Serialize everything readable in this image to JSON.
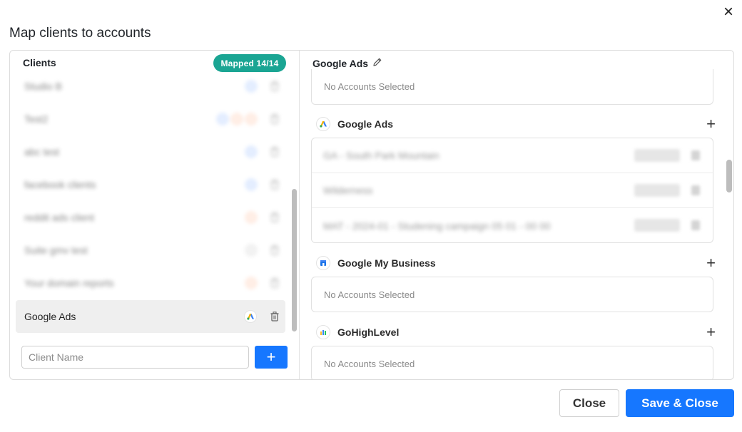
{
  "modal": {
    "title": "Map clients to accounts",
    "close_icon": "×"
  },
  "clients": {
    "header": "Clients",
    "mapped_badge": "Mapped 14/14",
    "rows": [
      {
        "name": "Studio B",
        "icons": [
          "blue"
        ],
        "blurred": true
      },
      {
        "name": "Test2",
        "icons": [
          "blue",
          "orange",
          "orange"
        ],
        "blurred": true
      },
      {
        "name": "abc test",
        "icons": [
          "blue"
        ],
        "blurred": true
      },
      {
        "name": "facebook clients",
        "icons": [
          "blue"
        ],
        "blurred": true
      },
      {
        "name": "reddit ads client",
        "icons": [
          "orange"
        ],
        "blurred": true
      },
      {
        "name": "Suite gmv test",
        "icons": [
          "gray"
        ],
        "blurred": true
      },
      {
        "name": "Your domain reports",
        "icons": [
          "orange"
        ],
        "blurred": true
      },
      {
        "name": "Google Ads",
        "icons": [
          "google-ads"
        ],
        "blurred": false,
        "active": true
      }
    ],
    "input_placeholder": "Client Name",
    "add_button": "+"
  },
  "detail": {
    "header": "Google Ads",
    "top_empty": "No Accounts Selected",
    "sections": [
      {
        "title": "Google Ads",
        "icon": "google-ads-icon",
        "add": "+",
        "accounts": [
          {
            "name": "GA - South Park Mountain"
          },
          {
            "name": "Wilderness"
          },
          {
            "name": "MAT - 2024-01 - Studening campaign 05 01 - 00 00"
          }
        ]
      },
      {
        "title": "Google My Business",
        "icon": "google-my-business-icon",
        "add": "+",
        "empty": "No Accounts Selected"
      },
      {
        "title": "GoHighLevel",
        "icon": "gohighlevel-icon",
        "add": "+",
        "empty": "No Accounts Selected"
      }
    ]
  },
  "footer": {
    "close_label": "Close",
    "save_label": "Save & Close"
  },
  "colors": {
    "accent": "#1677ff",
    "badge": "#1aa593"
  }
}
